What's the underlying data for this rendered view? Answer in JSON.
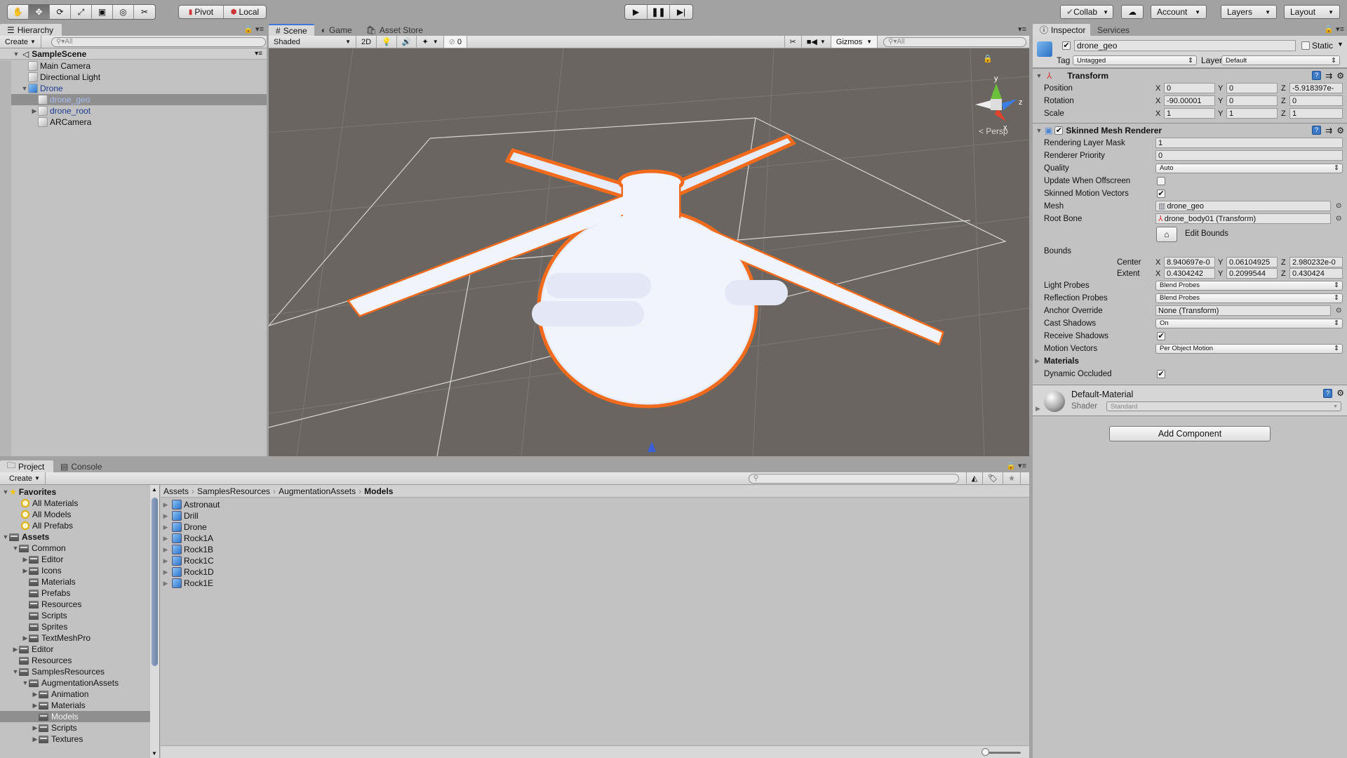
{
  "toolbar": {
    "tools": [
      {
        "name": "hand-tool",
        "active": false
      },
      {
        "name": "move-tool",
        "active": true
      },
      {
        "name": "rotate-tool",
        "active": false
      },
      {
        "name": "scale-tool",
        "active": false
      },
      {
        "name": "rect-tool",
        "active": false
      },
      {
        "name": "transform-tool",
        "active": false
      },
      {
        "name": "custom-tool",
        "active": false
      }
    ],
    "pivot_label": "Pivot",
    "local_label": "Local",
    "collab_label": "Collab",
    "account_label": "Account",
    "layers_label": "Layers",
    "layout_label": "Layout"
  },
  "hierarchy": {
    "tab_label": "Hierarchy",
    "create_label": "Create",
    "search_placeholder": "All",
    "scene_name": "SampleScene",
    "items": [
      {
        "label": "Main Camera",
        "depth": 1,
        "expand": "",
        "type": "gameobject",
        "color": "#111111",
        "selected": false
      },
      {
        "label": "Directional Light",
        "depth": 1,
        "expand": "",
        "type": "gameobject",
        "color": "#111111",
        "selected": false
      },
      {
        "label": "Drone",
        "depth": 1,
        "expand": "open",
        "type": "prefab",
        "color": "#1a3b8f",
        "selected": false
      },
      {
        "label": "drone_geo",
        "depth": 2,
        "expand": "",
        "type": "gameobject",
        "color": "#aabdf2",
        "selected": true
      },
      {
        "label": "drone_root",
        "depth": 2,
        "expand": "closed",
        "type": "gameobject",
        "color": "#1a3b8f",
        "selected": false
      },
      {
        "label": "ARCamera",
        "depth": 2,
        "expand": "",
        "type": "gameobject-plus",
        "color": "#111111",
        "selected": false
      }
    ]
  },
  "scene": {
    "tabs": [
      {
        "label": "Scene",
        "icon": "grid-icon",
        "active": true
      },
      {
        "label": "Game",
        "icon": "pacman-icon",
        "active": false
      },
      {
        "label": "Asset Store",
        "icon": "bag-icon",
        "active": false
      }
    ],
    "shading_mode": "Shaded",
    "mode_2d_label": "2D",
    "hidden_count": "0",
    "gizmos_label": "Gizmos",
    "search_placeholder": "All",
    "projection_label": "Persp",
    "gizmo_axes": {
      "x": "x",
      "y": "y",
      "z": "z"
    }
  },
  "inspector": {
    "tabs": [
      {
        "label": "Inspector",
        "active": true
      },
      {
        "label": "Services",
        "active": false
      }
    ],
    "object_name": "drone_geo",
    "active": true,
    "static_label": "Static",
    "static": false,
    "tag_label": "Tag",
    "tag_value": "Untagged",
    "layer_label": "Layer",
    "layer_value": "Default",
    "transform": {
      "title": "Transform",
      "rows": [
        {
          "label": "Position",
          "x": "0",
          "y": "0",
          "z": "-5.918397e-"
        },
        {
          "label": "Rotation",
          "x": "-90.00001",
          "y": "0",
          "z": "0"
        },
        {
          "label": "Scale",
          "x": "1",
          "y": "1",
          "z": "1"
        }
      ]
    },
    "smr": {
      "title": "Skinned Mesh Renderer",
      "enabled": true,
      "rendering_layer_mask_label": "Rendering Layer Mask",
      "rendering_layer_mask": "1",
      "renderer_priority_label": "Renderer Priority",
      "renderer_priority": "0",
      "quality_label": "Quality",
      "quality": "Auto",
      "update_offscreen_label": "Update When Offscreen",
      "update_offscreen": false,
      "skinned_motion_label": "Skinned Motion Vectors",
      "skinned_motion": true,
      "mesh_label": "Mesh",
      "mesh": "drone_geo",
      "root_bone_label": "Root Bone",
      "root_bone": "drone_body01 (Transform)",
      "edit_bounds_label": "Edit Bounds",
      "bounds_label": "Bounds",
      "center_label": "Center",
      "center": {
        "x": "8.940697e-0",
        "y": "0.06104925",
        "z": "2.980232e-0"
      },
      "extent_label": "Extent",
      "extent": {
        "x": "0.4304242",
        "y": "0.2099544",
        "z": "0.430424"
      },
      "light_probes_label": "Light Probes",
      "light_probes": "Blend Probes",
      "reflection_probes_label": "Reflection Probes",
      "reflection_probes": "Blend Probes",
      "anchor_override_label": "Anchor Override",
      "anchor_override": "None (Transform)",
      "cast_shadows_label": "Cast Shadows",
      "cast_shadows": "On",
      "receive_shadows_label": "Receive Shadows",
      "receive_shadows": true,
      "motion_vectors_label": "Motion Vectors",
      "motion_vectors": "Per Object Motion",
      "materials_label": "Materials",
      "dynamic_occluded_label": "Dynamic Occluded",
      "dynamic_occluded": true
    },
    "material": {
      "name": "Default-Material",
      "shader_label": "Shader",
      "shader": "Standard"
    },
    "add_component_label": "Add Component"
  },
  "project": {
    "tabs": [
      {
        "label": "Project",
        "active": true
      },
      {
        "label": "Console",
        "active": false
      }
    ],
    "create_label": "Create",
    "favorites_label": "Favorites",
    "favorites": [
      "All Materials",
      "All Models",
      "All Prefabs"
    ],
    "assets_label": "Assets",
    "tree": [
      {
        "label": "Common",
        "depth": 1,
        "expand": "open",
        "selected": false
      },
      {
        "label": "Editor",
        "depth": 2,
        "expand": "closed",
        "selected": false
      },
      {
        "label": "Icons",
        "depth": 2,
        "expand": "closed",
        "selected": false
      },
      {
        "label": "Materials",
        "depth": 2,
        "expand": "",
        "selected": false
      },
      {
        "label": "Prefabs",
        "depth": 2,
        "expand": "",
        "selected": false
      },
      {
        "label": "Resources",
        "depth": 2,
        "expand": "",
        "selected": false
      },
      {
        "label": "Scripts",
        "depth": 2,
        "expand": "",
        "selected": false
      },
      {
        "label": "Sprites",
        "depth": 2,
        "expand": "",
        "selected": false
      },
      {
        "label": "TextMeshPro",
        "depth": 2,
        "expand": "closed",
        "selected": false
      },
      {
        "label": "Editor",
        "depth": 1,
        "expand": "closed",
        "selected": false
      },
      {
        "label": "Resources",
        "depth": 1,
        "expand": "",
        "selected": false
      },
      {
        "label": "SamplesResources",
        "depth": 1,
        "expand": "open",
        "selected": false
      },
      {
        "label": "AugmentationAssets",
        "depth": 2,
        "expand": "open",
        "selected": false
      },
      {
        "label": "Animation",
        "depth": 3,
        "expand": "closed",
        "selected": false
      },
      {
        "label": "Materials",
        "depth": 3,
        "expand": "closed",
        "selected": false
      },
      {
        "label": "Models",
        "depth": 3,
        "expand": "",
        "selected": true
      },
      {
        "label": "Scripts",
        "depth": 3,
        "expand": "closed",
        "selected": false
      },
      {
        "label": "Textures",
        "depth": 3,
        "expand": "closed",
        "selected": false
      }
    ],
    "breadcrumb": [
      "Assets",
      "SamplesResources",
      "AugmentationAssets",
      "Models"
    ],
    "files": [
      "Astronaut",
      "Drill",
      "Drone",
      "Rock1A",
      "Rock1B",
      "Rock1C",
      "Rock1D",
      "Rock1E"
    ]
  },
  "colors": {
    "selection_outline": "#f26b1d",
    "viewport_bg": "#6a6560",
    "panel_bg": "#c2c2c2",
    "accent": "#3c78d8"
  }
}
